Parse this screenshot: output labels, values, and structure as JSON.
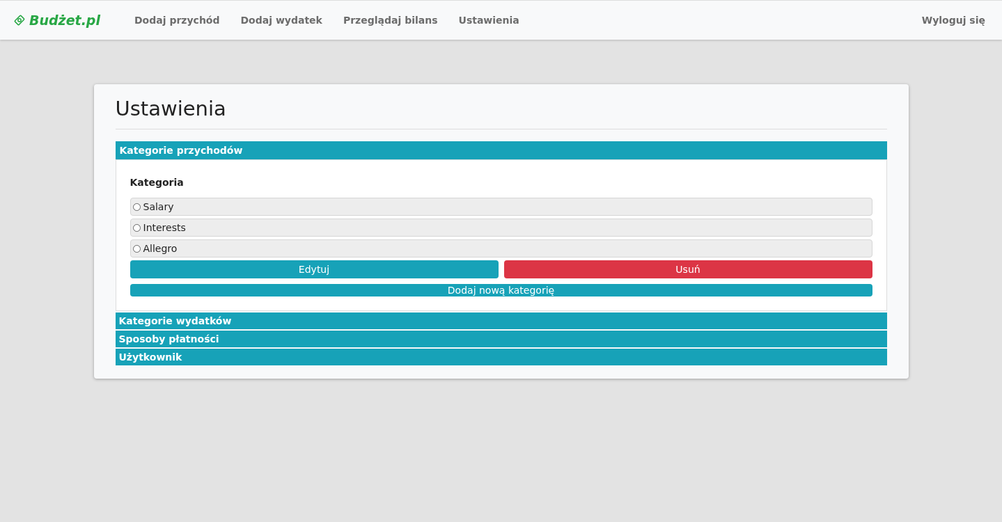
{
  "brand": "Budżet.pl",
  "nav": [
    {
      "label": "Dodaj przychód"
    },
    {
      "label": "Dodaj wydatek"
    },
    {
      "label": "Przeglądaj bilans"
    },
    {
      "label": "Ustawienia"
    }
  ],
  "logout": "Wyloguj się",
  "title": "Ustawienia",
  "sections": [
    {
      "label": "Kategorie przychodów",
      "expanded": true,
      "heading": "Kategoria",
      "options": [
        {
          "label": "Salary",
          "selected": false
        },
        {
          "label": "Interests",
          "selected": false
        },
        {
          "label": "Allegro",
          "selected": false
        }
      ],
      "edit_button": "Edytuj",
      "delete_button": "Usuń",
      "add_button": "Dodaj nową kategorię"
    },
    {
      "label": "Kategorie wydatków",
      "expanded": false
    },
    {
      "label": "Sposoby płatności",
      "expanded": false
    },
    {
      "label": "Użytkownik",
      "expanded": false
    }
  ]
}
